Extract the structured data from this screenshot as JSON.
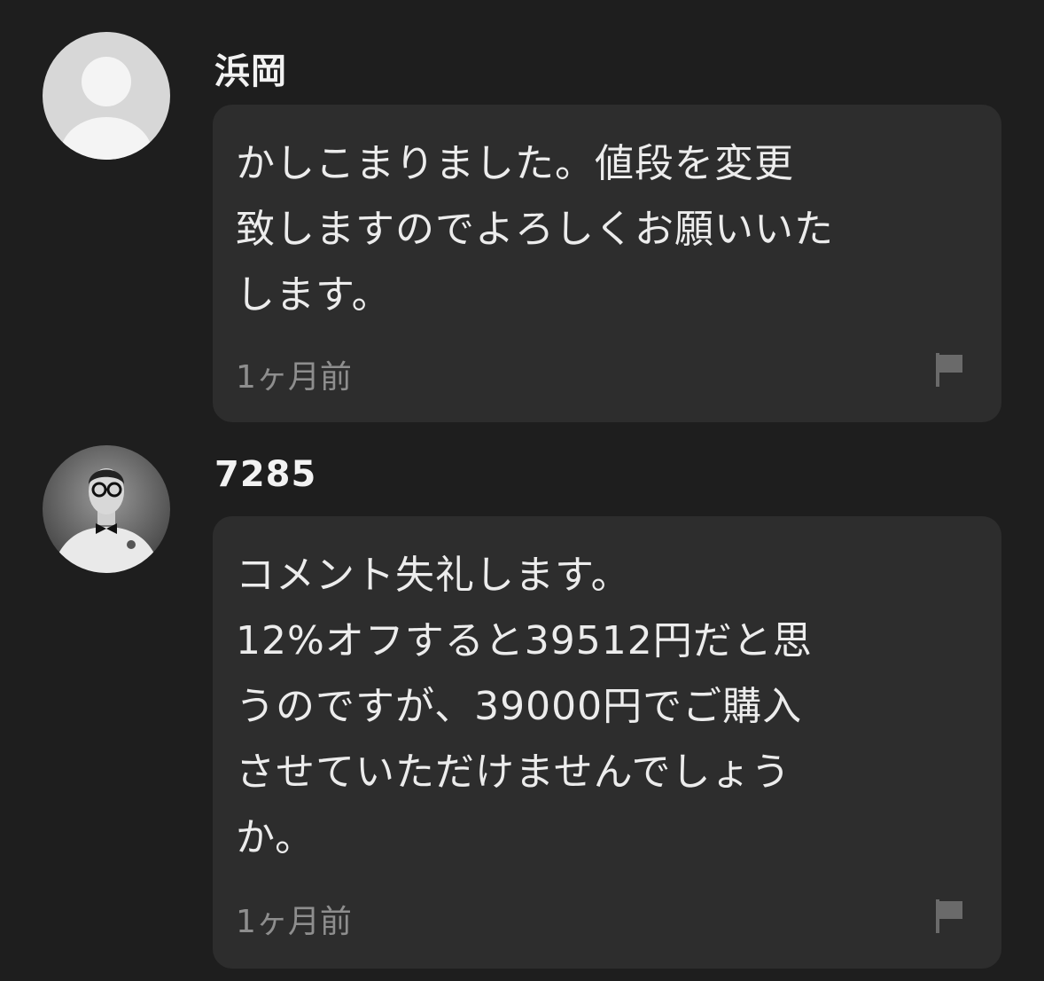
{
  "comments": [
    {
      "username": "浜岡",
      "avatar": "default-person-avatar",
      "text": "かしこまりました。値段を変更\n致しますのでよろしくお願いいた\nします。",
      "timestamp": "1ヶ月前",
      "flag_icon": "flag-icon"
    },
    {
      "username": "7285",
      "avatar": "photo-avatar-man-with-glasses",
      "text": "コメント失礼します。\n12%オフすると39512円だと思\nうのですが、39000円でご購入\nさせていただけませんでしょう\nか。",
      "timestamp": "1ヶ月前",
      "flag_icon": "flag-icon"
    }
  ],
  "colors": {
    "background": "#1e1e1e",
    "bubble": "#2d2d2d",
    "text": "#ececec",
    "muted": "#8e8e8e"
  }
}
